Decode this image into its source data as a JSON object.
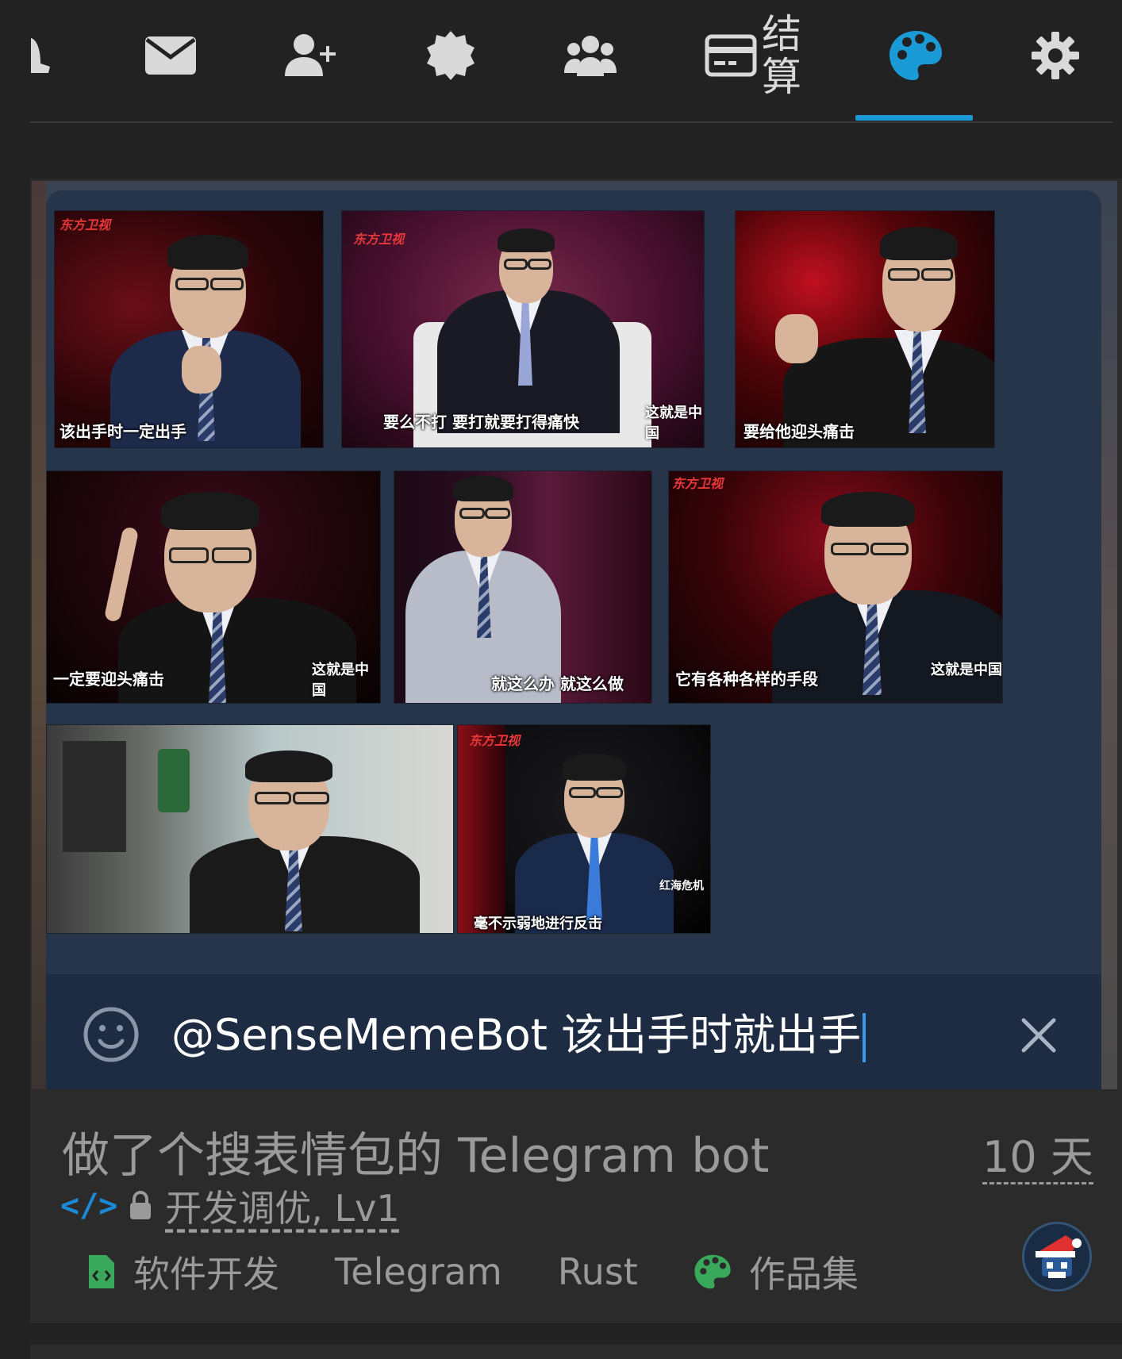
{
  "nav": {
    "settle_line1": "结",
    "settle_line2": "算",
    "accent": "#1a9ad6"
  },
  "preview": {
    "tiles": [
      {
        "caption": "该出手时一定出手",
        "logo": "东方卫视"
      },
      {
        "caption": "要么不打 要打就要打得痛快",
        "logo": "东方卫视",
        "wm": "这就是中国"
      },
      {
        "caption": "要给他迎头痛击"
      },
      {
        "caption": "一定要迎头痛击",
        "wm": "这就是中国"
      },
      {
        "caption": "就这么办 就这么做"
      },
      {
        "caption": "它有各种各样的手段",
        "logo": "东方卫视",
        "wm": "这就是中国"
      },
      {
        "caption": ""
      },
      {
        "caption": "毫不示弱地进行反击",
        "logo": "东方卫视",
        "wm": "红海危机"
      }
    ]
  },
  "input": {
    "query": "@SenseMemeBot 该出手时就出手"
  },
  "topic": {
    "title": "做了个搜表情包的 Telegram bot",
    "age": "10 天",
    "category": "开发调优, Lv1",
    "tags": [
      {
        "label": "软件开发",
        "icon": "file-code-icon",
        "color": "#3aa85a"
      },
      {
        "label": "Telegram"
      },
      {
        "label": "Rust"
      },
      {
        "label": "作品集",
        "icon": "palette-icon",
        "color": "#3aa85a"
      }
    ]
  }
}
